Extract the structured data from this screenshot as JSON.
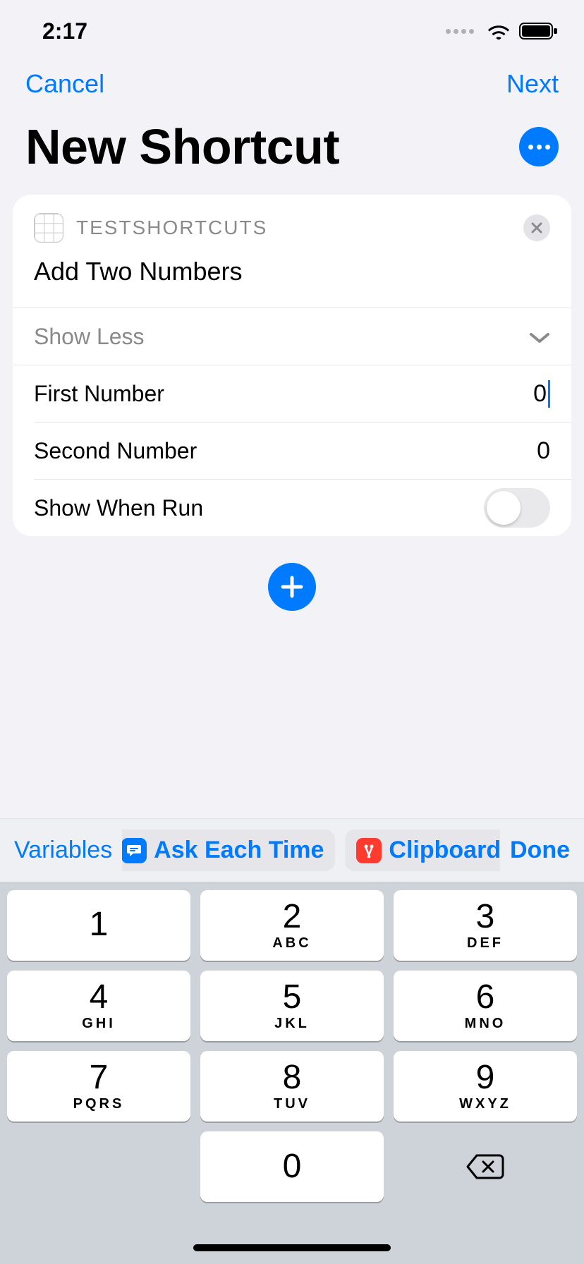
{
  "statusbar": {
    "time": "2:17"
  },
  "nav": {
    "cancel": "Cancel",
    "next": "Next"
  },
  "header": {
    "title": "New Shortcut"
  },
  "card": {
    "app_name": "TESTSHORTCUTS",
    "action_title": "Add Two Numbers",
    "show_less": "Show Less",
    "first_label": "First Number",
    "first_value": "0",
    "second_label": "Second Number",
    "second_value": "0",
    "show_when_run_label": "Show When Run",
    "show_when_run": false
  },
  "accessory": {
    "variables": "Variables",
    "ask": "Ask Each Time",
    "clipboard": "Clipboard",
    "done": "Done"
  },
  "keypad": [
    {
      "n": "1",
      "l": ""
    },
    {
      "n": "2",
      "l": "ABC"
    },
    {
      "n": "3",
      "l": "DEF"
    },
    {
      "n": "4",
      "l": "GHI"
    },
    {
      "n": "5",
      "l": "JKL"
    },
    {
      "n": "6",
      "l": "MNO"
    },
    {
      "n": "7",
      "l": "PQRS"
    },
    {
      "n": "8",
      "l": "TUV"
    },
    {
      "n": "9",
      "l": "WXYZ"
    }
  ],
  "keypad_zero": "0"
}
